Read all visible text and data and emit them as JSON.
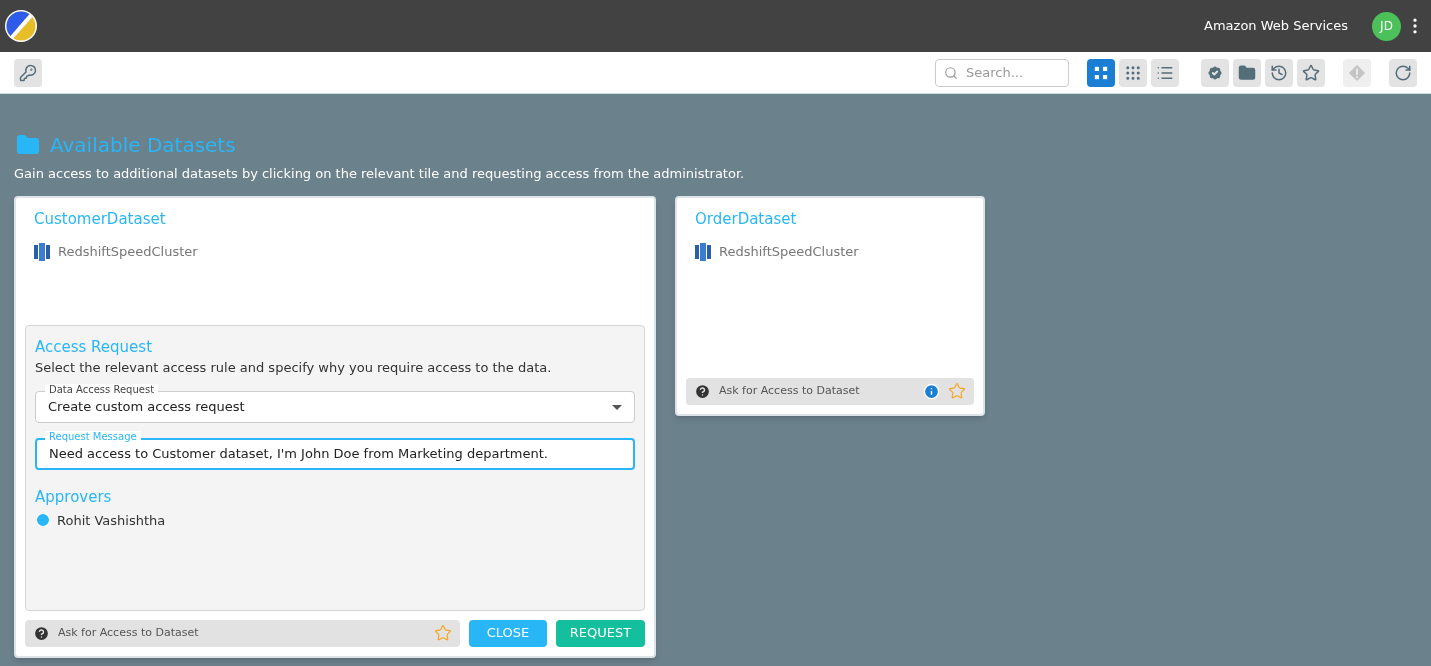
{
  "header": {
    "org": "Amazon Web Services",
    "avatar_initials": "JD"
  },
  "toolbar": {
    "search": {
      "placeholder": "Search..."
    },
    "view_buttons": [
      {
        "kind": "tiles",
        "selected": true
      },
      {
        "kind": "grid",
        "selected": false
      },
      {
        "kind": "list",
        "selected": false
      }
    ],
    "actions": [
      {
        "kind": "approved",
        "disabled": false
      },
      {
        "kind": "folder",
        "disabled": false
      },
      {
        "kind": "history",
        "disabled": false
      },
      {
        "kind": "favorites",
        "disabled": false
      },
      {
        "kind": "alert",
        "disabled": true
      },
      {
        "kind": "refresh",
        "disabled": false
      }
    ]
  },
  "page": {
    "title": "Available Datasets",
    "subtitle": "Gain access to additional datasets by clicking on the relevant tile and requesting access from the administrator."
  },
  "datasets": [
    {
      "name": "CustomerDataset",
      "source": "RedshiftSpeedCluster",
      "expanded": true,
      "footer": "Ask for Access to Dataset",
      "info": false,
      "starred": false,
      "access_request": {
        "title": "Access Request",
        "instructions": "Select the relevant access rule and specify why you require access to the data.",
        "rule_field": {
          "label": "Data Access Request",
          "value": "Create custom access request"
        },
        "message_field": {
          "label": "Request Message",
          "value": "Need access to Customer dataset, I'm John Doe from Marketing department."
        },
        "approvers_title": "Approvers",
        "approvers": [
          "Rohit Vashishtha"
        ]
      },
      "buttons": [
        "CLOSE",
        "REQUEST"
      ]
    },
    {
      "name": "OrderDataset",
      "source": "RedshiftSpeedCluster",
      "expanded": false,
      "footer": "Ask for Access to Dataset",
      "info": true,
      "starred": false
    }
  ]
}
